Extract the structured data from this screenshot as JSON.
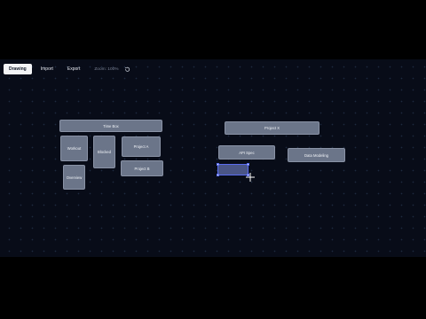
{
  "toolbar": {
    "buttons": [
      {
        "label": "Drawing",
        "active": true
      },
      {
        "label": "Import",
        "active": false
      },
      {
        "label": "Export",
        "active": false
      }
    ],
    "zoom_label": "Zoom: 100%",
    "reset_icon": "rotate-ccw-icon"
  },
  "nodes": {
    "time_box": "Time Box",
    "workout": "Workout",
    "blocked": "Blocked",
    "project_a": "Project A",
    "project_b": "Project B",
    "overview": "Overview",
    "project_x": "Project X",
    "api_spec": "API Spec",
    "data_modeling": "Data Modeling",
    "selected_node": ""
  },
  "colors": {
    "canvas_background": "#080c18",
    "node_fill": "#6b7589",
    "selection_accent": "#5a6cf0"
  }
}
